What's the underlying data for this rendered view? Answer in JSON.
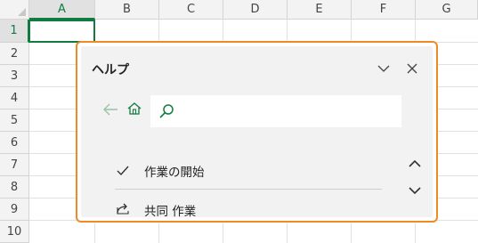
{
  "sheet": {
    "columns": [
      "A",
      "B",
      "C",
      "D",
      "E",
      "F",
      "G"
    ],
    "rows": [
      "1",
      "2",
      "3",
      "4",
      "5",
      "6",
      "7",
      "8",
      "9",
      "10"
    ],
    "selected_column": "A",
    "selected_row": "1"
  },
  "help_pane": {
    "title": "ヘルプ",
    "search": {
      "value": "",
      "placeholder": ""
    },
    "items": [
      {
        "label": "作業の開始",
        "icon": "check-icon"
      },
      {
        "label": "共同 作業",
        "icon": "share-icon"
      }
    ]
  },
  "colors": {
    "accent_green": "#107c41",
    "pane_border": "#f08a24"
  }
}
